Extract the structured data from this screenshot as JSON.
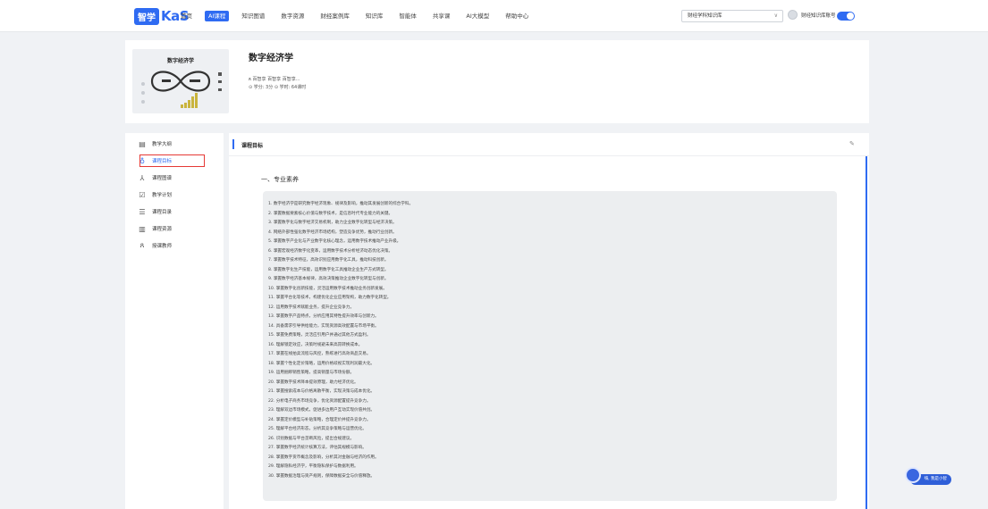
{
  "header": {
    "logo_box": "智学",
    "logo_text": "KaS",
    "nav": [
      "首页",
      "AI课程",
      "知识图谱",
      "数字资源",
      "财经案例库",
      "知识库",
      "智能体",
      "共享课",
      "AI大模型",
      "帮助中心"
    ],
    "active_nav_index": 1,
    "kb_select_value": "财经学科知识库",
    "user_name": "财经知识库账号",
    "accent": "#2f6bf2"
  },
  "course": {
    "cover_title": "数字经济学",
    "title": "数字经济学",
    "teachers": "ጸ 百智享 百智享 百智享...",
    "meta": "⊙ 学分: 3分   ⊙ 学时: 64课时"
  },
  "sidebar": {
    "items": [
      {
        "label": "教学大纲",
        "icon": "document-icon"
      },
      {
        "label": "课程目标",
        "icon": "location-pin-icon"
      },
      {
        "label": "课程图谱",
        "icon": "graph-icon"
      },
      {
        "label": "教学计划",
        "icon": "checklist-icon"
      },
      {
        "label": "课程目录",
        "icon": "list-icon"
      },
      {
        "label": "课程资源",
        "icon": "folder-icon"
      },
      {
        "label": "授课教师",
        "icon": "teacher-icon"
      }
    ],
    "active_index": 1
  },
  "main": {
    "header_title": "课程目标",
    "section_title": "一、专业素养",
    "goals": [
      "1. 数字经济学是研究数字经济现象、规律及影响，推动其发展创新的综合学科。",
      "2. 掌握数据要素核心价值与数字技术，是信息时代专业能力的关键。",
      "3. 掌握数字化与数字经济交易机制，助力企业数字化转型与经济决策。",
      "4. 网络外部性强化数字经济市场结构，塑造竞争优势，推动行业创新。",
      "5. 掌握数字产业化与产业数字化核心理念，运用数字技术推动产业升级。",
      "6. 掌握宏观经济数字化变革，运用数字技术分析经济动态优化决策。",
      "7. 掌握数字技术特征，高效识别应用数字化工具，推动科技创新。",
      "8. 掌握数字化生产技能，运用数字化工具推动企业生产方式转型。",
      "9. 掌握数字经济基本规律，高效决策推动企业数字化转型与创新。",
      "10. 掌握数字化创新技能，灵活运用数字技术推动业务创新发展。",
      "11. 掌握平台化等技术，构建优化企业应用架构，助力数字化转型。",
      "12. 运用数字技术赋能业务，提升企业竞争力。",
      "13. 掌握数字产品特点，分析应用其特性提升效率与创新力。",
      "14. 具备需求引导供给能力，实现资源高效配置与市场平衡。",
      "15. 掌握免费策略，灵活应引用户并通过其他方式盈利。",
      "16. 理解锁定效应，决策时规避未来高昂转换成本。",
      "17. 掌握在线拍卖流程与风控，熟练进行高效商品交易。",
      "18. 掌握个性化定价策略，运用价格歧视实现利润最大化。",
      "19. 运用捆绑销售策略，提高销量与市场份额。",
      "20. 掌握数字技术降本提效原理，助力经济优化。",
      "21. 掌握搜索成本与价格离散平衡，实现决策与成本优化。",
      "22. 分析电子商务市场竞争，优化资源配置提升竞争力。",
      "23. 理解双边市场模式，促进多边用户互动实现价值共创。",
      "24. 掌握定价模型与补贴策略，合理定价并提升竞争力。",
      "25. 理解平台经济形态，分析其竞争策略与运营优化。",
      "26. 识别数据与平台垄断风险，提出合规建议。",
      "27. 掌握数字经济统计核算方法，评估其规模与影响。",
      "28. 掌握数字货币概念及影响，分析其对金融与经济的作用。",
      "29. 理解隐私经济学，平衡隐私保护与数据利用。",
      "30. 掌握数据治理与资产规则，保障数据安全与价值释放。"
    ]
  },
  "assistant": {
    "label": "嗨, 我是小智"
  }
}
